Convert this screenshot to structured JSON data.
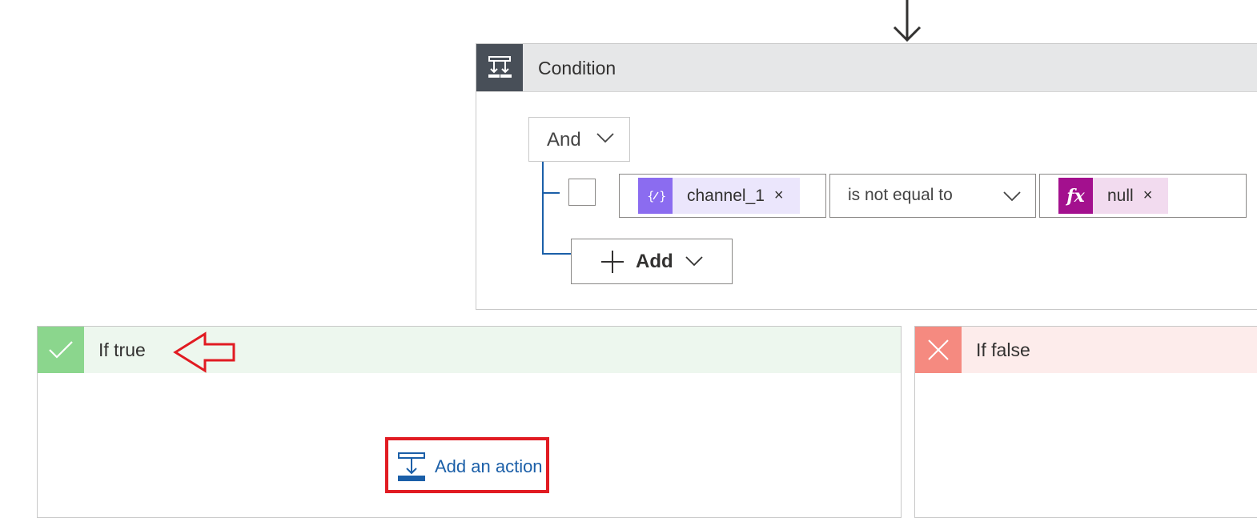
{
  "condition": {
    "title": "Condition",
    "group_operator": "And",
    "row": {
      "left_token": {
        "label": "channel_1",
        "icon": "dynamic-content-icon",
        "color": "#8b6cf0",
        "remove": "×"
      },
      "operator": "is not equal to",
      "right_token": {
        "label": "null",
        "icon": "expression-fx-icon",
        "icon_glyph": "fx",
        "color": "#a3108e",
        "remove": "×"
      }
    },
    "add_label": "Add"
  },
  "branches": {
    "true_title": "If true",
    "false_title": "If false"
  },
  "add_action_label": "Add an action",
  "colors": {
    "accent": "#1b5fa8",
    "true": "#8bd68d",
    "false": "#f58a80",
    "annotation": "#e11b22"
  }
}
